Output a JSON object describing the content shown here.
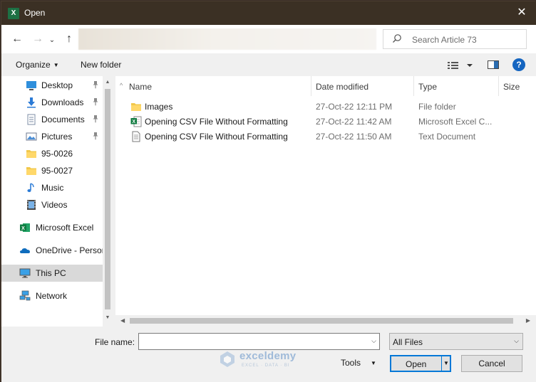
{
  "window": {
    "title": "Open",
    "app_icon_letter": "X",
    "close_glyph": "✕"
  },
  "nav": {
    "back_glyph": "←",
    "forward_glyph": "→",
    "recent_glyph": "⌄",
    "up_glyph": "↑",
    "search_placeholder": "Search Article 73"
  },
  "toolbar": {
    "organize_label": "Organize",
    "organize_caret": "▼",
    "new_folder_label": "New folder",
    "help_label": "?"
  },
  "sidebar": {
    "items": [
      {
        "label": "Desktop",
        "icon": "desktop-icon",
        "pinned": true
      },
      {
        "label": "Downloads",
        "icon": "downloads-icon",
        "pinned": true
      },
      {
        "label": "Documents",
        "icon": "documents-icon",
        "pinned": true
      },
      {
        "label": "Pictures",
        "icon": "pictures-icon",
        "pinned": true
      },
      {
        "label": "95-0026",
        "icon": "folder-icon",
        "pinned": false
      },
      {
        "label": "95-0027",
        "icon": "folder-icon",
        "pinned": false
      },
      {
        "label": "Music",
        "icon": "music-icon",
        "pinned": false
      },
      {
        "label": "Videos",
        "icon": "videos-icon",
        "pinned": false
      },
      {
        "label": "Microsoft Excel",
        "icon": "excel-icon",
        "pinned": false
      },
      {
        "label": "OneDrive - Person",
        "icon": "onedrive-icon",
        "pinned": false
      },
      {
        "label": "This PC",
        "icon": "this-pc-icon",
        "pinned": false,
        "selected": true
      },
      {
        "label": "Network",
        "icon": "network-icon",
        "pinned": false
      }
    ],
    "pin_glyph": "📌"
  },
  "filelist": {
    "columns": {
      "name": "Name",
      "date": "Date modified",
      "type": "Type",
      "size": "Size"
    },
    "sort_glyph": "^",
    "rows": [
      {
        "name": "Images",
        "date": "27-Oct-22 12:11 PM",
        "type": "File folder",
        "icon": "folder-icon"
      },
      {
        "name": "Opening CSV File Without Formatting",
        "date": "27-Oct-22 11:42 AM",
        "type": "Microsoft Excel C...",
        "icon": "excel-csv-icon"
      },
      {
        "name": "Opening CSV File Without Formatting",
        "date": "27-Oct-22 11:50 AM",
        "type": "Text Document",
        "icon": "text-document-icon"
      }
    ]
  },
  "bottom": {
    "file_name_label": "File name:",
    "file_name_value": "",
    "filter_value": "All Files",
    "tools_label": "Tools",
    "open_label": "Open",
    "cancel_label": "Cancel",
    "dropdown_glyph": "⌵"
  },
  "watermark": {
    "name": "exceldemy",
    "tagline": "EXCEL · DATA · BI"
  },
  "colors": {
    "titlebar": "#3b3024",
    "accent": "#0078d7",
    "excel_green": "#1d7044",
    "help_blue": "#1565c0"
  }
}
